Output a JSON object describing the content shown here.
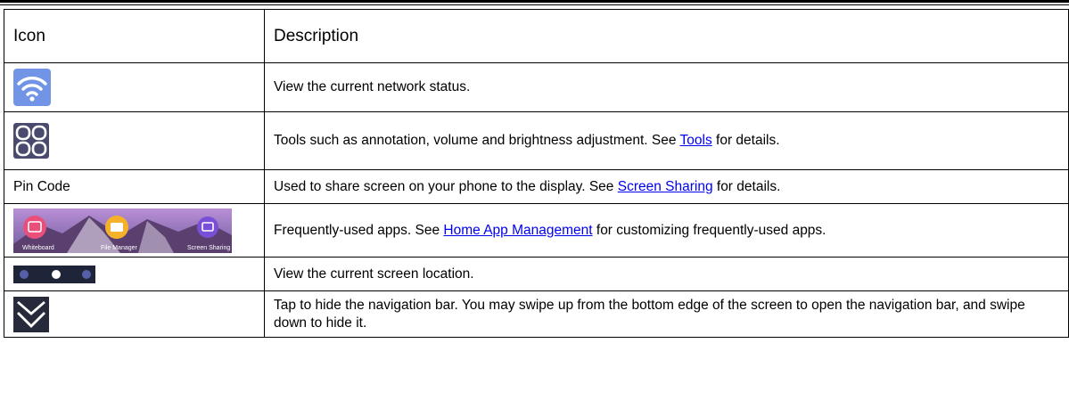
{
  "table": {
    "header": {
      "icon": "Icon",
      "description": "Description"
    },
    "rows": [
      {
        "icon_name": "wifi-icon",
        "desc_before": "View the current network status.",
        "link": "",
        "desc_after": ""
      },
      {
        "icon_name": "tools-grid-icon",
        "desc_before": "Tools such as annotation, volume and brightness adjustment. See ",
        "link": "Tools",
        "desc_after": " for details."
      },
      {
        "icon_text": "Pin Code",
        "desc_before": "Used to share screen on your phone to the display. See ",
        "link": "Screen Sharing",
        "desc_after": " for details."
      },
      {
        "icon_name": "home-apps-strip-icon",
        "app_labels": [
          "Whiteboard",
          "File Manager",
          "Screen Sharing"
        ],
        "desc_before": "Frequently-used apps. See ",
        "link": "Home App Management",
        "desc_after": " for customizing frequently-used apps."
      },
      {
        "icon_name": "page-indicator-dots-icon",
        "desc_before": "View the current screen location.",
        "link": "",
        "desc_after": ""
      },
      {
        "icon_name": "double-chevron-down-icon",
        "desc_before": "Tap to hide the navigation bar. You may swipe up from the bottom edge of the screen to open the navigation bar, and swipe down to hide it.",
        "link": "",
        "desc_after": ""
      }
    ]
  },
  "colors": {
    "link": "#0000ee",
    "wifi_bg": "#6f8fe0",
    "tools_bg": "#4a4a6e",
    "dots_bg": "#1f2538",
    "chevron_bg": "#262a3a"
  }
}
